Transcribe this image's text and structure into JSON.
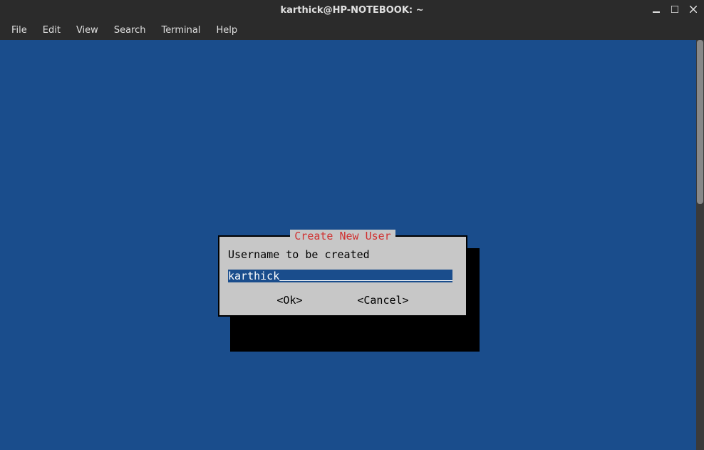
{
  "window": {
    "title": "karthick@HP-NOTEBOOK: ~"
  },
  "menu": {
    "file": "File",
    "edit": "Edit",
    "view": "View",
    "search": "Search",
    "terminal": "Terminal",
    "help": "Help"
  },
  "dialog": {
    "title": "Create New User",
    "prompt": "Username to be created",
    "input_value": "karthick",
    "ok_label": "<Ok>",
    "cancel_label": "<Cancel>"
  }
}
